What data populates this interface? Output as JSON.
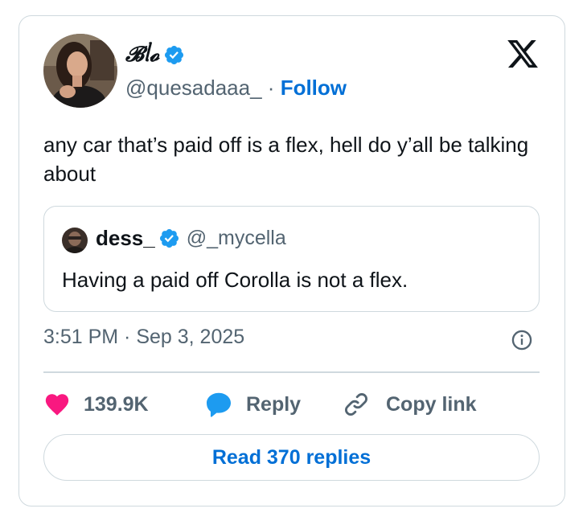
{
  "author": {
    "display_name": "𝓑ᥣ𝓸",
    "handle": "@quesadaaa_",
    "separator": "·",
    "follow_label": "Follow"
  },
  "tweet": {
    "text": "any car that’s paid off is a flex, hell do y’all be talking about",
    "timestamp": "3:51 PM · Sep 3, 2025"
  },
  "quoted": {
    "display_name": "dess_",
    "handle": "@_mycella",
    "text": "Having a paid off Corolla is not a flex."
  },
  "actions": {
    "like_count": "139.9K",
    "reply_label": "Reply",
    "copy_label": "Copy link"
  },
  "footer": {
    "read_replies_label": "Read 370 replies"
  },
  "colors": {
    "accent": "#006fd6",
    "verified": "#1d9bf0",
    "like": "#f91880",
    "secondary_text": "#536471",
    "border": "#cfd9de"
  },
  "icons": [
    "verified-badge-icon",
    "x-logo-icon",
    "info-icon",
    "heart-icon",
    "reply-icon",
    "link-icon"
  ]
}
